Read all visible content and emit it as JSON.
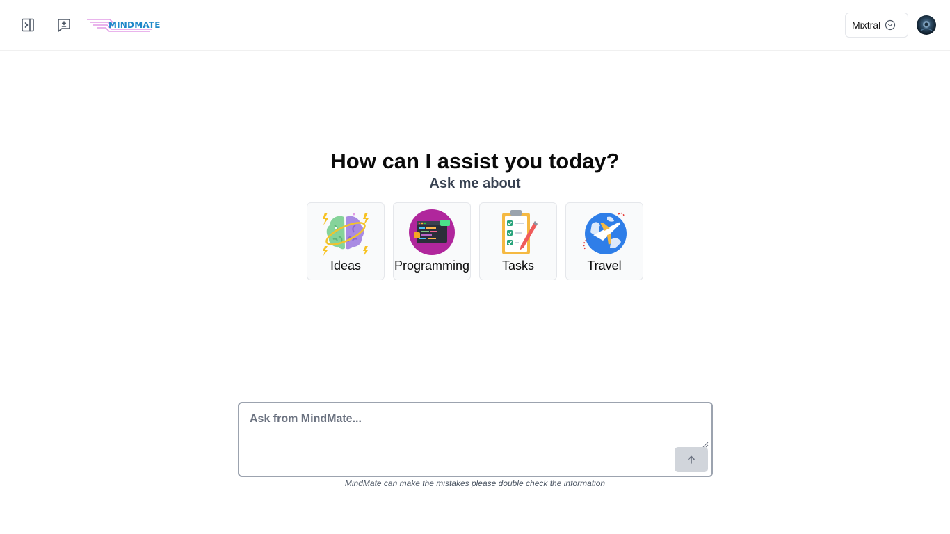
{
  "header": {
    "logo_text": "MINDMATE",
    "model_select": {
      "selected": "Mixtral"
    }
  },
  "hero": {
    "title": "How can I assist you today?",
    "subtitle": "Ask me about"
  },
  "topics": [
    {
      "label": "Ideas",
      "icon": "brain-icon"
    },
    {
      "label": "Programming",
      "icon": "code-window-icon"
    },
    {
      "label": "Tasks",
      "icon": "checklist-icon"
    },
    {
      "label": "Travel",
      "icon": "airplane-globe-icon"
    }
  ],
  "composer": {
    "placeholder": "Ask from MindMate...",
    "value": "",
    "disclaimer": "MindMate can make the mistakes please double check the information"
  },
  "colors": {
    "accent": "#1e88c9",
    "send_button_disabled": "#d1d5db",
    "card_background": "#f9fafb"
  }
}
